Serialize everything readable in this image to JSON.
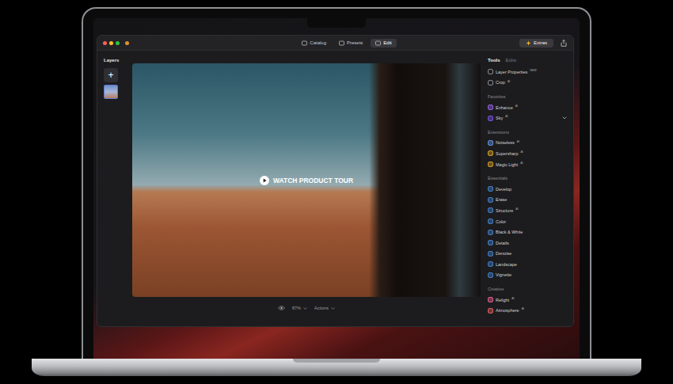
{
  "window": {
    "tabs": [
      {
        "label": "Catalog",
        "selected": false
      },
      {
        "label": "Presets",
        "selected": false
      },
      {
        "label": "Edit",
        "selected": true
      }
    ],
    "extras_button": "Extras"
  },
  "layers": {
    "title": "Layers",
    "add_button": "+"
  },
  "canvas": {
    "overlay": "WATCH PRODUCT TOUR",
    "zoom": "87%",
    "actions": "Actions"
  },
  "tools_panel": {
    "tabs": [
      {
        "label": "Tools",
        "selected": true
      },
      {
        "label": "Edits",
        "selected": false
      }
    ],
    "pinned_items": [
      {
        "label": "Layer Properties",
        "badge": "NEW",
        "chevron": false,
        "color": "#9aa0a6"
      },
      {
        "label": "Crop",
        "badge": "AI",
        "chevron": false,
        "color": "#9aa0a6"
      }
    ],
    "sections": [
      {
        "title": "Favorites",
        "items": [
          {
            "label": "Enhance",
            "badge": "AI",
            "chevron": false,
            "color": "#a66cff"
          },
          {
            "label": "Sky",
            "badge": "AI",
            "chevron": true,
            "color": "#8a5cff"
          }
        ]
      },
      {
        "title": "Extensions",
        "items": [
          {
            "label": "Noiseless",
            "badge": "AI",
            "chevron": false,
            "color": "#6fa8ff"
          },
          {
            "label": "Supersharp",
            "badge": "AI",
            "chevron": false,
            "color": "#f0b429"
          },
          {
            "label": "Magic Light",
            "badge": "AI",
            "chevron": false,
            "color": "#f0b429"
          }
        ]
      },
      {
        "title": "Essentials",
        "items": [
          {
            "label": "Develop",
            "badge": "",
            "chevron": false,
            "color": "#4a90e2"
          },
          {
            "label": "Erase",
            "badge": "",
            "chevron": false,
            "color": "#4a90e2"
          },
          {
            "label": "Structure",
            "badge": "AI",
            "chevron": false,
            "color": "#4a90e2"
          },
          {
            "label": "Color",
            "badge": "",
            "chevron": false,
            "color": "#4a90e2"
          },
          {
            "label": "Black & White",
            "badge": "",
            "chevron": false,
            "color": "#4a90e2"
          },
          {
            "label": "Details",
            "badge": "",
            "chevron": false,
            "color": "#4a90e2"
          },
          {
            "label": "Denoise",
            "badge": "",
            "chevron": false,
            "color": "#4a90e2"
          },
          {
            "label": "Landscape",
            "badge": "",
            "chevron": false,
            "color": "#4a90e2"
          },
          {
            "label": "Vignette",
            "badge": "",
            "chevron": false,
            "color": "#4a90e2"
          }
        ]
      },
      {
        "title": "Creative",
        "items": [
          {
            "label": "Relight",
            "badge": "AI",
            "chevron": false,
            "color": "#ff6b9a"
          },
          {
            "label": "Atmosphere",
            "badge": "AI",
            "chevron": false,
            "color": "#ff6b6b"
          }
        ]
      }
    ]
  }
}
